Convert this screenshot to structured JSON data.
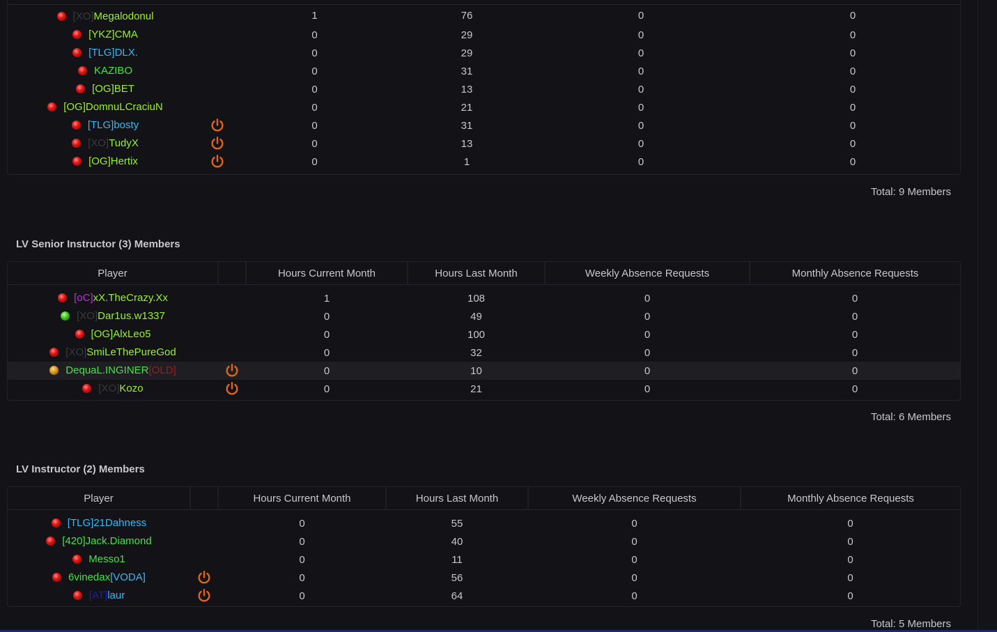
{
  "top_panel": {
    "rows": [
      {
        "status": "red",
        "tag": "[XO]",
        "tag_class": "tag-gray",
        "name": "Megalodonul",
        "name_class": "c-lime",
        "power": false,
        "current": "1",
        "last": "76",
        "weekly": "0",
        "monthly": "0"
      },
      {
        "status": "red",
        "tag": "[YKZ]",
        "tag_class": "c-lime",
        "name": "CMA",
        "name_class": "c-lime",
        "power": false,
        "current": "0",
        "last": "29",
        "weekly": "0",
        "monthly": "0"
      },
      {
        "status": "red",
        "tag": "[TLG]",
        "tag_class": "c-cyan",
        "name": "DLX.",
        "name_class": "c-cyan",
        "power": false,
        "current": "0",
        "last": "29",
        "weekly": "0",
        "monthly": "0"
      },
      {
        "status": "red",
        "tag": "",
        "tag_class": "",
        "name": "KAZIBO",
        "name_class": "c-green",
        "power": false,
        "current": "0",
        "last": "31",
        "weekly": "0",
        "monthly": "0"
      },
      {
        "status": "red",
        "tag": "[OG]",
        "tag_class": "c-lime",
        "name": "BET",
        "name_class": "c-lime",
        "power": false,
        "current": "0",
        "last": "13",
        "weekly": "0",
        "monthly": "0"
      },
      {
        "status": "red",
        "tag": "[OG]",
        "tag_class": "c-lime",
        "name": "DomnuLCraciuN",
        "name_class": "c-lime",
        "power": false,
        "current": "0",
        "last": "21",
        "weekly": "0",
        "monthly": "0"
      },
      {
        "status": "red",
        "tag": "[TLG]",
        "tag_class": "c-cyan",
        "name": "bosty",
        "name_class": "c-cyan",
        "power": true,
        "current": "0",
        "last": "31",
        "weekly": "0",
        "monthly": "0"
      },
      {
        "status": "red",
        "tag": "[XO]",
        "tag_class": "tag-gray",
        "name": "TudyX",
        "name_class": "c-lime",
        "power": true,
        "current": "0",
        "last": "13",
        "weekly": "0",
        "monthly": "0"
      },
      {
        "status": "red",
        "tag": "[OG]",
        "tag_class": "c-lime",
        "name": "Hertix",
        "name_class": "c-lime",
        "power": true,
        "current": "0",
        "last": "1",
        "weekly": "0",
        "monthly": "0"
      }
    ],
    "total": "Total: 9 Members"
  },
  "senior": {
    "title": "LV Senior Instructor (3) Members",
    "headers": {
      "player": "Player",
      "current": "Hours Current Month",
      "last": "Hours Last Month",
      "weekly": "Weekly Absence Requests",
      "monthly": "Monthly Absence Requests"
    },
    "rows": [
      {
        "status": "red",
        "tag": "[oC]",
        "tag_class": "tag-purple",
        "name": "xX.TheCrazy.Xx",
        "name_class": "c-lime",
        "suffix": "",
        "suffix_class": "",
        "power": false,
        "current": "1",
        "last": "108",
        "weekly": "0",
        "monthly": "0"
      },
      {
        "status": "green",
        "tag": "[XO]",
        "tag_class": "tag-gray",
        "name": "Dar1us.w1337",
        "name_class": "c-lime",
        "suffix": "",
        "suffix_class": "",
        "power": false,
        "current": "0",
        "last": "49",
        "weekly": "0",
        "monthly": "0"
      },
      {
        "status": "red",
        "tag": "[OG]",
        "tag_class": "c-lime",
        "name": "AlxLeo5",
        "name_class": "c-lime",
        "suffix": "",
        "suffix_class": "",
        "power": false,
        "current": "0",
        "last": "100",
        "weekly": "0",
        "monthly": "0"
      },
      {
        "status": "red",
        "tag": "[XO]",
        "tag_class": "tag-gray",
        "name": "SmiLeThePureGod",
        "name_class": "c-lime",
        "suffix": "",
        "suffix_class": "",
        "power": false,
        "current": "0",
        "last": "32",
        "weekly": "0",
        "monthly": "0"
      },
      {
        "status": "yellow",
        "tag": "",
        "tag_class": "",
        "name": "DequaL.INGINER",
        "name_class": "c-green",
        "suffix": "[OLD]",
        "suffix_class": "tag-red",
        "power": true,
        "current": "0",
        "last": "10",
        "weekly": "0",
        "monthly": "0",
        "highlight": true
      },
      {
        "status": "red",
        "tag": "[XO]",
        "tag_class": "tag-gray",
        "name": "Kozo",
        "name_class": "c-lime",
        "suffix": "",
        "suffix_class": "",
        "power": true,
        "current": "0",
        "last": "21",
        "weekly": "0",
        "monthly": "0"
      }
    ],
    "total": "Total: 6 Members"
  },
  "instructor": {
    "title": "LV Instructor (2) Members",
    "headers": {
      "player": "Player",
      "current": "Hours Current Month",
      "last": "Hours Last Month",
      "weekly": "Weekly Absence Requests",
      "monthly": "Monthly Absence Requests"
    },
    "rows": [
      {
        "status": "red",
        "tag": "[TLG]",
        "tag_class": "c-cyan",
        "name": "21Dahness",
        "name_class": "c-cyan",
        "suffix": "",
        "suffix_class": "",
        "power": false,
        "current": "0",
        "last": "55",
        "weekly": "0",
        "monthly": "0"
      },
      {
        "status": "red",
        "tag": "[420]",
        "tag_class": "c-green",
        "name": "Jack.Diamond",
        "name_class": "c-green",
        "suffix": "",
        "suffix_class": "",
        "power": false,
        "current": "0",
        "last": "40",
        "weekly": "0",
        "monthly": "0"
      },
      {
        "status": "red",
        "tag": "",
        "tag_class": "",
        "name": "Messo1",
        "name_class": "c-green",
        "suffix": "",
        "suffix_class": "",
        "power": false,
        "current": "0",
        "last": "11",
        "weekly": "0",
        "monthly": "0"
      },
      {
        "status": "red",
        "tag": "",
        "tag_class": "",
        "name": "6vinedax",
        "name_class": "c-green",
        "suffix": "[VODA]",
        "suffix_class": "c-cyan",
        "power": true,
        "current": "0",
        "last": "56",
        "weekly": "0",
        "monthly": "0"
      },
      {
        "status": "red",
        "tag": "[AT]",
        "tag_class": "tag-blue",
        "name": "laur",
        "name_class": "c-cyan",
        "suffix": "",
        "suffix_class": "",
        "power": true,
        "current": "0",
        "last": "64",
        "weekly": "0",
        "monthly": "0"
      }
    ],
    "total": "Total: 5 Members"
  },
  "colors": {
    "background": "#131317",
    "power_icon": "#e0641c",
    "text": "#c8c8cc"
  },
  "icons": {
    "status": "status-dot-icon",
    "power": "power-icon"
  }
}
